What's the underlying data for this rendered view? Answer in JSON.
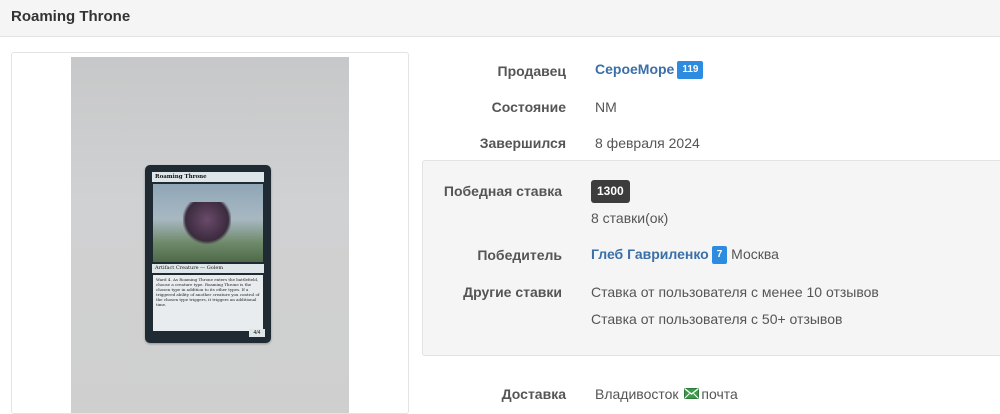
{
  "page": {
    "title": "Roaming Throne"
  },
  "card": {
    "name": "Roaming Throne",
    "type_line": "Artifact Creature — Golem",
    "rules_text": "Ward 4. As Roaming Throne enters the battlefield, choose a creature type. Roaming Throne is the chosen type in addition to its other types. If a triggered ability of another creature you control of the chosen type triggers, it triggers an additional time.",
    "pt": "4/4"
  },
  "details": {
    "seller_label": "Продавец",
    "seller_name": "СероеМоре",
    "seller_badge": "119",
    "condition_label": "Состояние",
    "condition_value": "NM",
    "ended_label": "Завершился",
    "ended_value": "8 февраля 2024"
  },
  "bid": {
    "winning_label": "Победная ставка",
    "winning_amount": "1300",
    "bids_count": "8 ставки(ок)",
    "winner_label": "Победитель",
    "winner_name": "Глеб Гавриленко",
    "winner_badge": "7",
    "winner_city": "Москва",
    "other_label": "Другие ставки",
    "other_1": "Ставка от пользователя с менее 10 отзывов",
    "other_2": "Ставка от пользователя с 50+ отзывов"
  },
  "delivery": {
    "label": "Доставка",
    "city": "Владивосток",
    "method": "почта",
    "icon": "mail-icon"
  },
  "colors": {
    "link": "#3a6fa8",
    "badge": "#2d8ce0",
    "amount_bg": "#3d3d3d",
    "mail_icon": "#3a9a4a"
  }
}
